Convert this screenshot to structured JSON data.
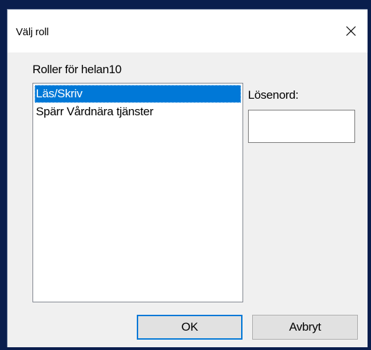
{
  "dialog": {
    "title": "Välj roll",
    "close_icon": "close-icon"
  },
  "roles": {
    "label": "Roller för helan10",
    "items": [
      {
        "label": "Läs/Skriv",
        "selected": true
      },
      {
        "label": "Spärr Vårdnära tjänster",
        "selected": false
      }
    ]
  },
  "password": {
    "label": "Lösenord:",
    "value": ""
  },
  "buttons": {
    "ok_label": "OK",
    "cancel_label": "Avbryt"
  },
  "colors": {
    "selection": "#0078d7",
    "dialog_bg": "#f0f0f0",
    "desktop_bg": "#0a1e4d"
  }
}
